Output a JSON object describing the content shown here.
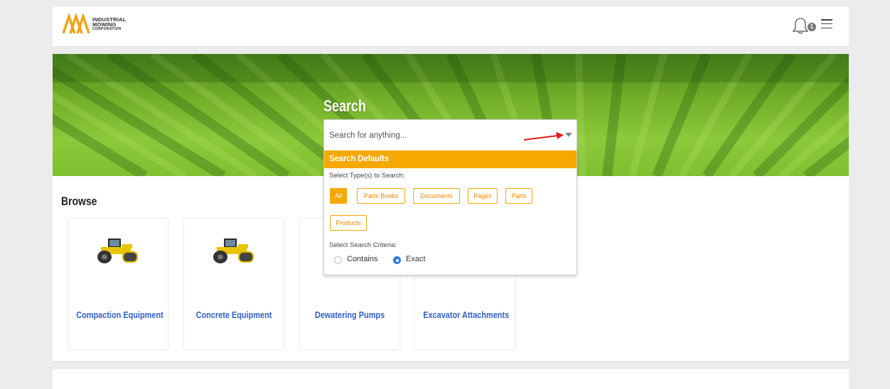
{
  "header": {
    "logo": {
      "line1": "INDUSTRIAL",
      "line2": "MOWING",
      "line3": "CORPORATION"
    },
    "notification_count": "1"
  },
  "browse": {
    "title": "Browse",
    "cards": [
      {
        "label": "Compaction Equipment"
      },
      {
        "label": "Concrete Equipment"
      },
      {
        "label": "Dewatering Pumps"
      },
      {
        "label": "Excavator Attachments"
      }
    ]
  },
  "search": {
    "title": "Search",
    "placeholder": "Search for anything...",
    "defaults_title": "Search Defaults",
    "types_label": "Select Type(s) to Search:",
    "types": [
      "All",
      "Parts Books",
      "Documents",
      "Pages",
      "Parts",
      "Products"
    ],
    "active_type": "All",
    "criteria_label": "Select Search Criteria:",
    "criteria": [
      "Contains",
      "Exact"
    ],
    "selected_criteria": "Exact"
  },
  "colors": {
    "accent": "#f5a800",
    "link": "#3360c8",
    "radio_selected": "#2f7be0",
    "annotation_arrow": "#e01b1b"
  }
}
